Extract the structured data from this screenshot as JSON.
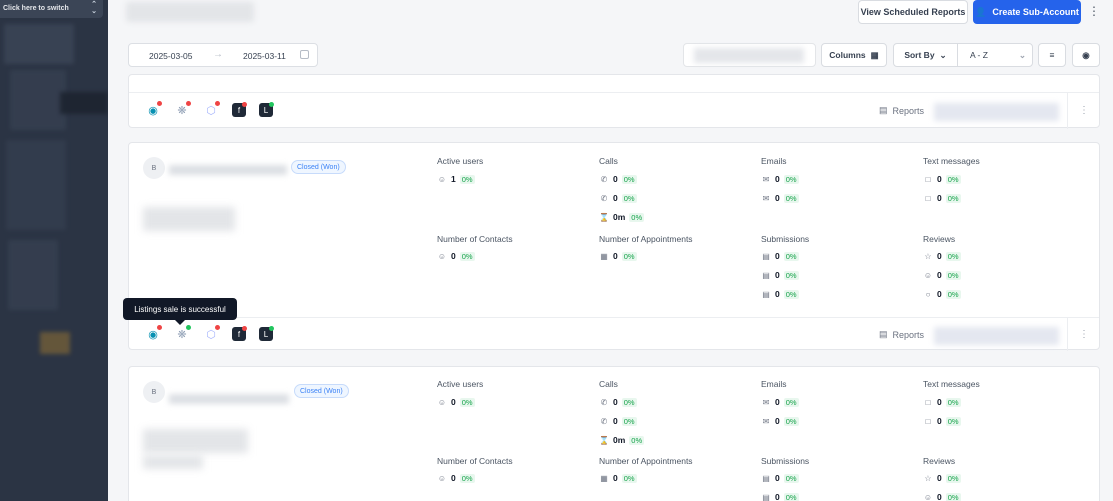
{
  "sidebar": {
    "switcher_label": "Click here to switch"
  },
  "header": {
    "view_scheduled_label": "View Scheduled Reports",
    "create_sub_account_label": "Create Sub-Account"
  },
  "filters": {
    "date_start": "2025-03-05",
    "date_end": "2025-03-11",
    "columns_label": "Columns",
    "sort_by_label": "Sort By",
    "sort_value": "A - Z"
  },
  "reports_label": "Reports",
  "tooltip": "Listings sale is successful",
  "cards": [
    {
      "avatar": "B",
      "badge": "Closed (Won)",
      "labels": {
        "active_users": "Active users",
        "calls": "Calls",
        "emails": "Emails",
        "text_messages": "Text messages",
        "contacts": "Number of Contacts",
        "appointments": "Number of Appointments",
        "submissions": "Submissions",
        "reviews": "Reviews"
      },
      "active_users": {
        "value": "1",
        "pct": "0%"
      },
      "calls": [
        {
          "value": "0",
          "pct": "0%"
        },
        {
          "value": "0",
          "pct": "0%"
        },
        {
          "value": "0m",
          "pct": "0%"
        }
      ],
      "emails": [
        {
          "value": "0",
          "pct": "0%"
        },
        {
          "value": "0",
          "pct": "0%"
        }
      ],
      "texts": [
        {
          "value": "0",
          "pct": "0%"
        },
        {
          "value": "0",
          "pct": "0%"
        }
      ],
      "contacts": {
        "value": "0",
        "pct": "0%"
      },
      "appointments": {
        "value": "0",
        "pct": "0%"
      },
      "submissions": [
        {
          "value": "0",
          "pct": "0%"
        },
        {
          "value": "0",
          "pct": "0%"
        },
        {
          "value": "0",
          "pct": "0%"
        }
      ],
      "reviews": [
        {
          "value": "0",
          "pct": "0%"
        },
        {
          "value": "0",
          "pct": "0%"
        },
        {
          "value": "0",
          "pct": "0%"
        }
      ]
    },
    {
      "avatar": "B",
      "badge": "Closed (Won)",
      "labels": {
        "active_users": "Active users",
        "calls": "Calls",
        "emails": "Emails",
        "text_messages": "Text messages",
        "contacts": "Number of Contacts",
        "appointments": "Number of Appointments",
        "submissions": "Submissions",
        "reviews": "Reviews"
      },
      "active_users": {
        "value": "0",
        "pct": "0%"
      },
      "calls": [
        {
          "value": "0",
          "pct": "0%"
        },
        {
          "value": "0",
          "pct": "0%"
        },
        {
          "value": "0m",
          "pct": "0%"
        }
      ],
      "emails": [
        {
          "value": "0",
          "pct": "0%"
        },
        {
          "value": "0",
          "pct": "0%"
        }
      ],
      "texts": [
        {
          "value": "0",
          "pct": "0%"
        },
        {
          "value": "0",
          "pct": "0%"
        }
      ],
      "contacts": {
        "value": "0",
        "pct": "0%"
      },
      "appointments": {
        "value": "0",
        "pct": "0%"
      },
      "submissions": [
        {
          "value": "0",
          "pct": "0%"
        },
        {
          "value": "0",
          "pct": "0%"
        }
      ],
      "reviews": [
        {
          "value": "0",
          "pct": "0%"
        },
        {
          "value": "0",
          "pct": "0%"
        }
      ]
    }
  ],
  "colors": {
    "primary": "#2563eb",
    "sidebar": "#2b3444",
    "positive": "#16a34a",
    "alert_dot": "#ef4444",
    "ok_dot": "#22c55e"
  }
}
